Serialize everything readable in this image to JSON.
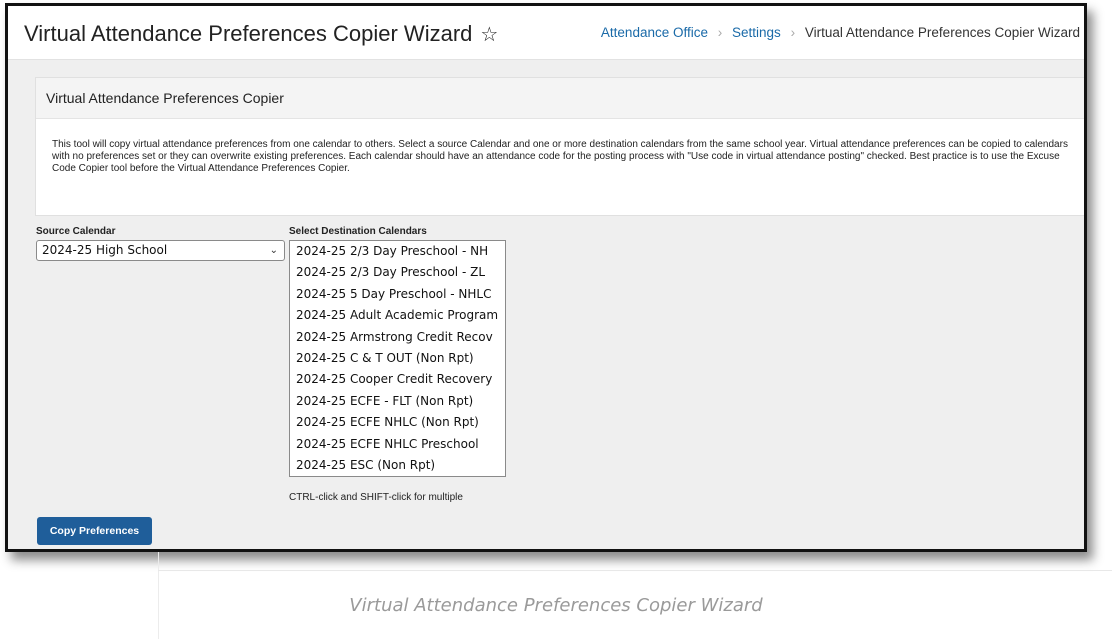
{
  "header": {
    "title": "Virtual Attendance Preferences Copier Wizard",
    "star_glyph": "☆",
    "breadcrumb": {
      "items": [
        "Attendance Office",
        "Settings"
      ],
      "current": "Virtual Attendance Preferences Copier Wizard",
      "separator": "›"
    }
  },
  "panel": {
    "title": "Virtual Attendance Preferences Copier",
    "description": "This tool will copy virtual attendance preferences from one calendar to others. Select a source Calendar and one or more destination calendars from the same school year. Virtual attendance preferences can be copied to calendars with no preferences set or they can overwrite existing preferences. Each calendar should have an attendance code for the posting process with \"Use code in virtual attendance posting\" checked. Best practice is to use the Excuse Code Copier tool before the Virtual Attendance Preferences Copier."
  },
  "source": {
    "label": "Source Calendar",
    "selected": "2024-25 High School",
    "chevron": "⌄"
  },
  "destination": {
    "label": "Select Destination Calendars",
    "options": [
      "2024-25 2/3 Day Preschool - NH",
      "2024-25 2/3 Day Preschool - ZL",
      "2024-25 5 Day Preschool - NHLC",
      "2024-25 Adult Academic Program",
      "2024-25 Armstrong Credit Recov",
      "2024-25 C & T OUT (Non Rpt)",
      "2024-25 Cooper Credit Recovery",
      "2024-25 ECFE - FLT (Non Rpt)",
      "2024-25 ECFE NHLC (Non Rpt)",
      "2024-25 ECFE NHLC Preschool",
      "2024-25 ESC (Non Rpt)"
    ],
    "hint": "CTRL-click and SHIFT-click for multiple"
  },
  "actions": {
    "copy_label": "Copy Preferences"
  },
  "caption": "Virtual Attendance Preferences Copier Wizard",
  "colors": {
    "link": "#1a6aa8",
    "button": "#1f5e9a",
    "background": "#efefef"
  }
}
